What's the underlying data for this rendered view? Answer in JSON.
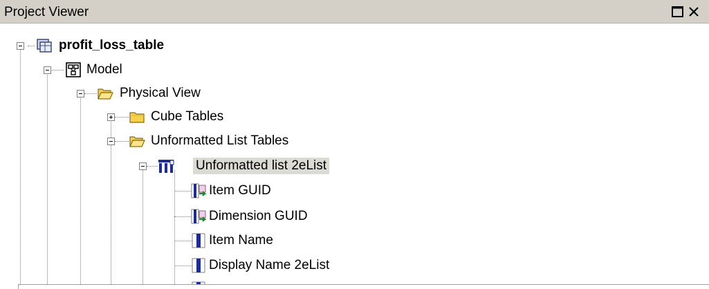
{
  "panel": {
    "title": "Project Viewer",
    "buttons": {
      "maximize_icon": "maximize-icon",
      "close_icon": "close-icon"
    }
  },
  "tree": {
    "root": {
      "label": "profit_loss_table",
      "icon": "database-table-icon",
      "expanded": true
    },
    "model": {
      "label": "Model",
      "icon": "model-icon",
      "expanded": true
    },
    "physical_view": {
      "label": "Physical View",
      "icon": "open-folder-icon",
      "expanded": true
    },
    "cube_tables": {
      "label": "Cube Tables",
      "icon": "folder-icon",
      "expanded": false
    },
    "unformatted_list_tables": {
      "label": "Unformatted List Tables",
      "icon": "open-folder-icon",
      "expanded": true
    },
    "unformatted_list": {
      "label": "Unformatted list 2eList",
      "icon": "table-columns-icon",
      "expanded": true,
      "selected": true
    },
    "columns": [
      {
        "label": "Item GUID",
        "icon": "key-column-icon"
      },
      {
        "label": "Dimension GUID",
        "icon": "key-column-icon"
      },
      {
        "label": "Item Name",
        "icon": "column-icon"
      },
      {
        "label": "Display Name 2eList",
        "icon": "column-icon"
      }
    ]
  },
  "colors": {
    "titlebar": "#d4d0c8",
    "selection": "#dcdad5",
    "folder": "#f6d24a",
    "column_blue": "#1c2b9c"
  }
}
